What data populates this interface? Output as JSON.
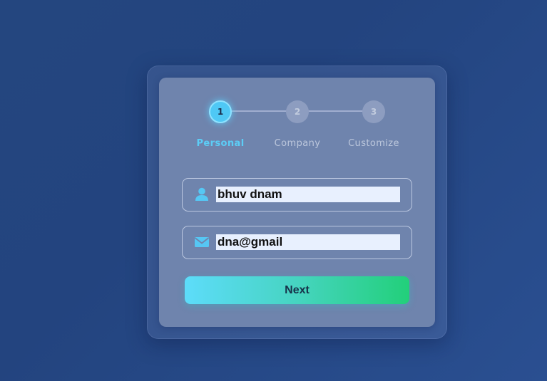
{
  "stepper": {
    "steps": [
      {
        "number": "1",
        "label": "Personal",
        "state": "active"
      },
      {
        "number": "2",
        "label": "Company",
        "state": "inactive"
      },
      {
        "number": "3",
        "label": "Customize",
        "state": "inactive"
      }
    ]
  },
  "form": {
    "name_field": {
      "value": "bhuv dnam",
      "icon": "user-icon"
    },
    "email_field": {
      "value": "dna@gmail",
      "icon": "envelope-icon"
    },
    "next_label": "Next"
  },
  "colors": {
    "accent": "#4fc8f5",
    "button_start": "#5ddcfa",
    "button_end": "#22d07a",
    "background": "#24467f",
    "card": "#6f84ad"
  }
}
